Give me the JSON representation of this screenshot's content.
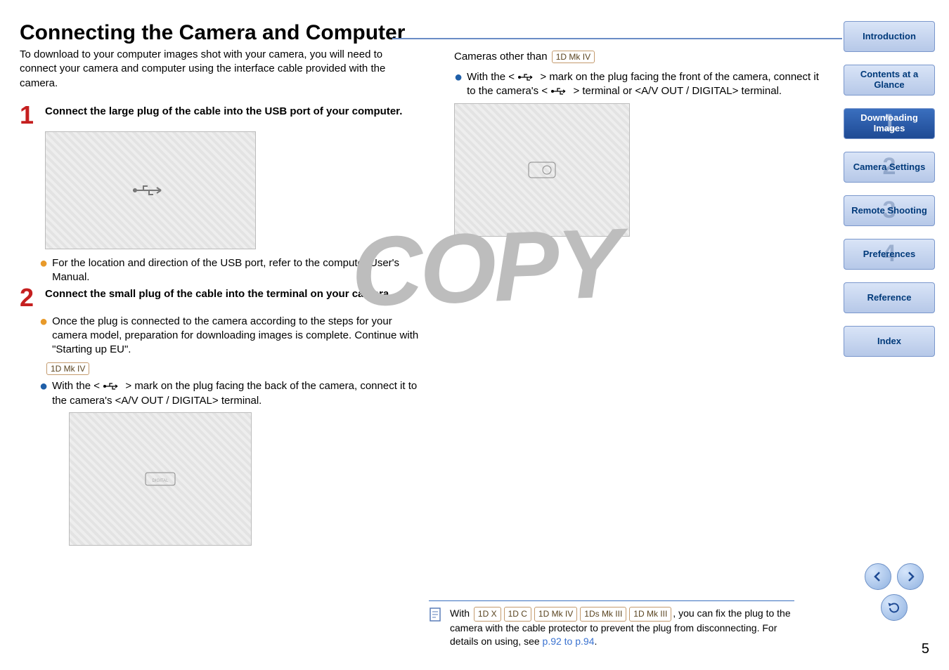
{
  "title": "Connecting the Camera and Computer",
  "intro": "To download to your computer images shot with your camera, you will need to connect your camera and computer using the interface cable provided with the camera.",
  "step1": {
    "num": "1",
    "text": "Connect the large plug of the cable into the USB port of your computer.",
    "bullet": "For the location and direction of the USB port, refer to the computer User's Manual."
  },
  "step2": {
    "num": "2",
    "text": "Connect the small plug of the cable into the terminal on your camera.",
    "bullet": "Once the plug is connected to the camera according to the steps for your camera model, preparation for downloading images is complete. Continue with \"Starting up EU\".",
    "tag": "1D Mk IV",
    "note1a": "With the < ",
    "note1b": " > mark on the plug facing the back of the camera, connect it to the camera's <A/V OUT / DIGITAL> terminal."
  },
  "right": {
    "heading": "Cameras other than",
    "heading_tag": "1D Mk IV",
    "note1a": "With the < ",
    "note1b": " > mark on the plug facing the front of the camera, connect it to the camera's < ",
    "note1c": " > terminal or <A/V OUT / DIGITAL> terminal."
  },
  "footnote": {
    "prefix": "With ",
    "tags": [
      "1D X",
      "1D C",
      "1D Mk IV",
      "1Ds Mk III",
      "1D Mk III"
    ],
    "suffix": ", you can fix the plug to the camera with the cable protector to prevent the plug from disconnecting. For details on using, see ",
    "page_ref": "p.92 to p.94",
    "period": "."
  },
  "watermark": "COPY",
  "page_number": "5",
  "nav": {
    "intro": "Introduction",
    "contents": "Contents at a Glance",
    "downloading": "Downloading Images",
    "camera": "Camera Settings",
    "remote": "Remote Shooting",
    "prefs": "Preferences",
    "reference": "Reference",
    "index": "Index",
    "n1": "1",
    "n2": "2",
    "n3": "3",
    "n4": "4"
  }
}
